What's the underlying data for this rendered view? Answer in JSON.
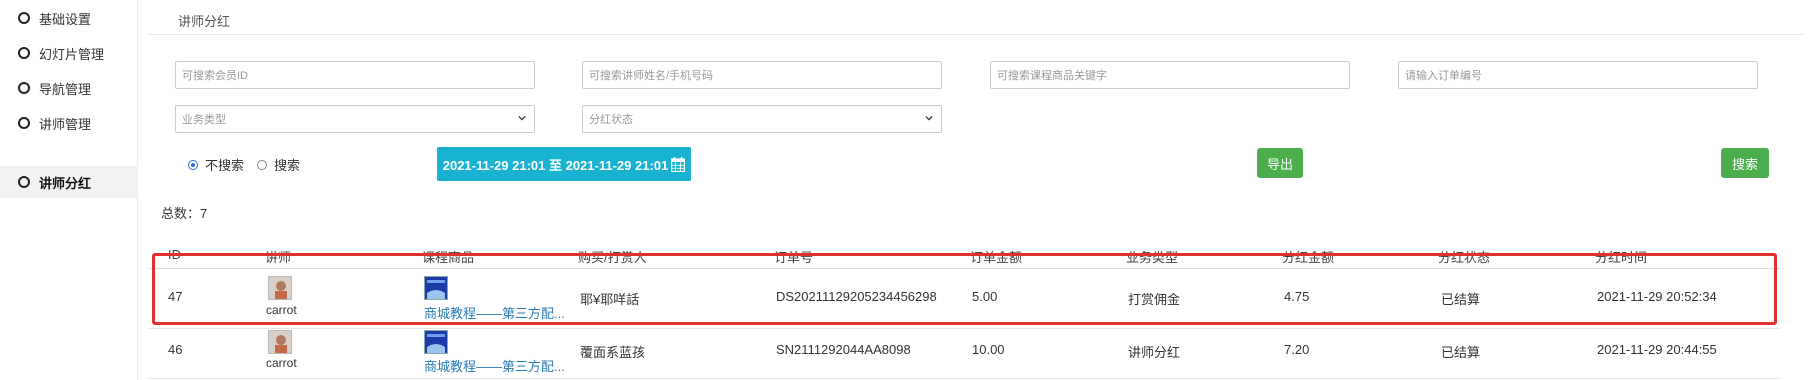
{
  "sidebar": {
    "items": [
      {
        "label": "基础设置",
        "active": false
      },
      {
        "label": "幻灯片管理",
        "active": false
      },
      {
        "label": "导航管理",
        "active": false
      },
      {
        "label": "讲师管理",
        "active": false
      },
      {
        "label": "讲师分红",
        "active": true
      }
    ]
  },
  "page": {
    "title": "讲师分红"
  },
  "filters": {
    "member_id_placeholder": "可搜索会员ID",
    "teacher_placeholder": "可搜索讲师姓名/手机号码",
    "course_placeholder": "可搜索课程商品关键字",
    "order_placeholder": "请输入订单编号",
    "business_type": "业务类型",
    "dividend_status": "分红状态",
    "radio_no_search": "不搜索",
    "radio_search": "搜索",
    "date_range": "2021-11-29 21:01 至 2021-11-29 21:01",
    "export_label": "导出",
    "search_label": "搜索"
  },
  "summary": {
    "total_label": "总数：",
    "total_value": "7"
  },
  "table": {
    "headers": [
      "ID",
      "讲师",
      "课程商品",
      "购买/打赏人",
      "订单号",
      "订单金额",
      "业务类型",
      "分红金额",
      "分红状态",
      "分红时间"
    ],
    "rows": [
      {
        "id": "47",
        "teacher": "carrot",
        "course": "商城教程——第三方配...",
        "buyer": "耶¥耶咩話",
        "order_no": "DS20211129205234456298",
        "amount": "5.00",
        "type": "打赏佣金",
        "dividend": "4.75",
        "status": "已结算",
        "time": "2021-11-29 20:52:34"
      },
      {
        "id": "46",
        "teacher": "carrot",
        "course": "商城教程——第三方配...",
        "buyer": "覆面系蓝孩",
        "order_no": "SN2111292044AA8098",
        "amount": "10.00",
        "type": "讲师分红",
        "dividend": "7.20",
        "status": "已结算",
        "time": "2021-11-29 20:44:55"
      }
    ]
  },
  "colors": {
    "accent_cyan": "#17b3d1",
    "button_green": "#4cae4c",
    "highlight_red": "#e03030",
    "link_blue": "#2a7ab5"
  }
}
